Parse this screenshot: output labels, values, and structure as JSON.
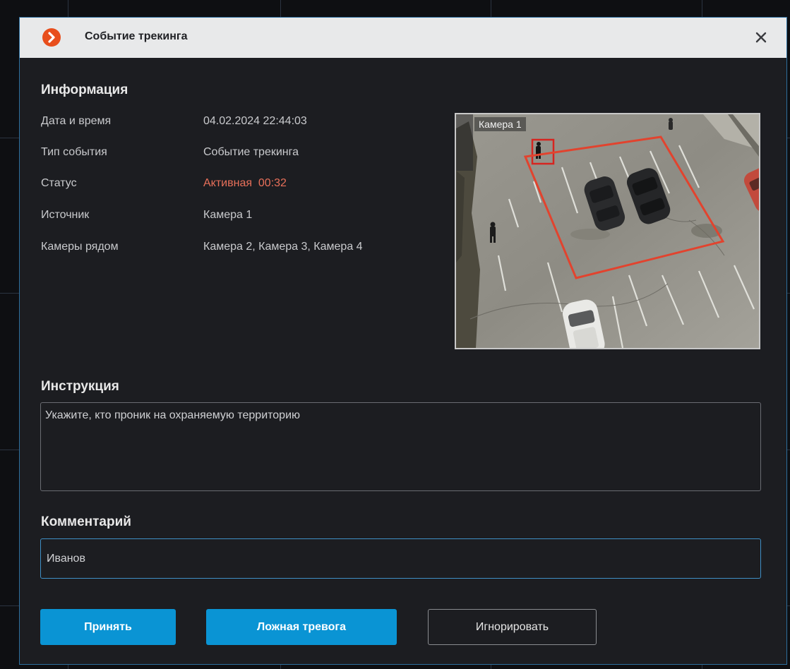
{
  "dialog": {
    "title": "Событие трекинга",
    "logo_icon": "chevron-right-icon",
    "close_icon": "close-icon",
    "accent_color": "#e84e1c"
  },
  "info": {
    "heading": "Информация",
    "rows": [
      {
        "label": "Дата и время",
        "value": "04.02.2024 22:44:03"
      },
      {
        "label": "Тип события",
        "value": "Событие трекинга"
      },
      {
        "label": "Статус",
        "value": "Активная  00:32"
      },
      {
        "label": "Источник",
        "value": "Камера 1"
      },
      {
        "label": "Камеры рядом",
        "value": "Камера 2, Камера 3, Камера 4"
      }
    ],
    "status_color": "#e8705a"
  },
  "preview": {
    "camera_label": "Камера 1"
  },
  "instruction": {
    "heading": "Инструкция",
    "text": "Укажите, кто проник на охраняемую территорию"
  },
  "comment": {
    "heading": "Комментарий",
    "value": "Иванов"
  },
  "buttons": {
    "accept": "Принять",
    "false_alarm": "Ложная тревога",
    "ignore": "Игнорировать"
  }
}
